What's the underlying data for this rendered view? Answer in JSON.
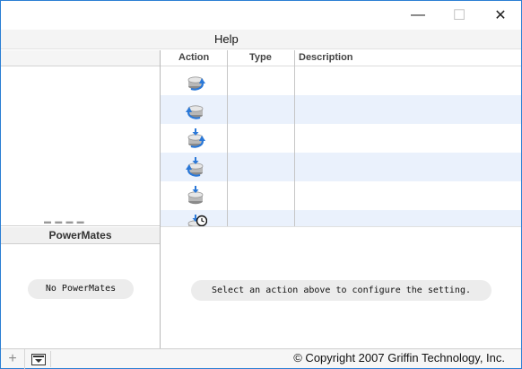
{
  "window": {
    "minimize_glyph": "—",
    "maximize_glyph": "☐",
    "close_glyph": "✕"
  },
  "menubar": {
    "help": "Help"
  },
  "table": {
    "headers": {
      "action": "Action",
      "type": "Type",
      "description": "Description"
    },
    "rows": [
      {
        "icon": "rotate-clockwise-icon",
        "alt": false
      },
      {
        "icon": "rotate-counterclockwise-icon",
        "alt": true
      },
      {
        "icon": "press-rotate-clockwise-icon",
        "alt": false
      },
      {
        "icon": "press-rotate-counterclockwise-icon",
        "alt": true
      },
      {
        "icon": "press-icon",
        "alt": false
      },
      {
        "icon": "long-press-icon",
        "alt": true
      }
    ]
  },
  "powermates": {
    "header": "PowerMates",
    "empty_label": "No PowerMates"
  },
  "settings": {
    "placeholder": "Select an action above to configure the setting."
  },
  "bottombar": {
    "add_glyph": "+",
    "copyright": "© Copyright 2007 Griffin Technology, Inc."
  },
  "colors": {
    "window_border": "#2b7fd4",
    "row_alt": "#eaf1fc",
    "icon_arrow": "#2a78d8"
  }
}
